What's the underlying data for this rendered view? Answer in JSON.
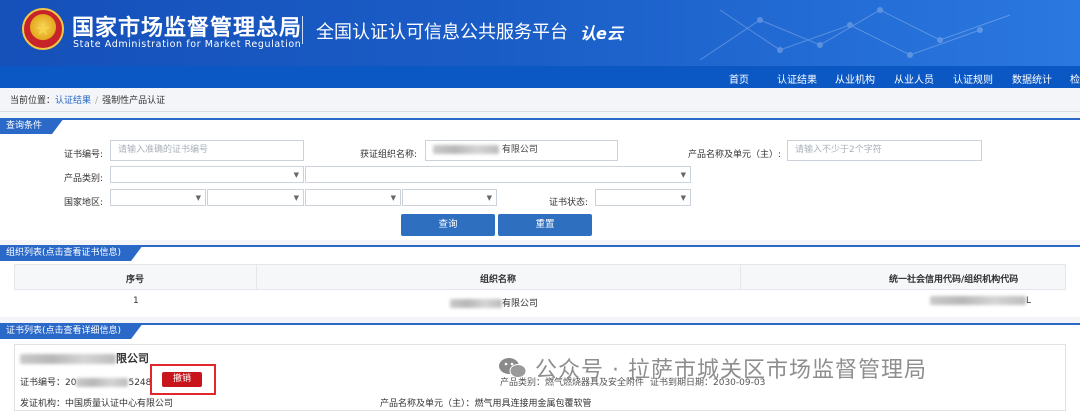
{
  "header": {
    "title_cn": "国家市场监督管理总局",
    "title_en": "State Administration  for  Market Regulation",
    "platform": "全国认证认可信息公共服务平台",
    "logo_text": "认e云"
  },
  "nav": {
    "items": [
      "首页",
      "认证结果",
      "从业机构",
      "从业人员",
      "认证规则",
      "数据统计",
      "检"
    ]
  },
  "breadcrumb": {
    "prefix": "当前位置：",
    "level1": "认证结果",
    "level2": "强制性产品认证"
  },
  "query": {
    "section_title": "查询条件",
    "cert_no_label": "证书编号:",
    "cert_no_placeholder": "请输入准确的证书编号",
    "org_label": "获证组织名称:",
    "org_value_suffix": "有限公司",
    "product_label": "产品名称及单元（主）:",
    "product_placeholder": "请输入不少于2个字符",
    "category_label": "产品类别:",
    "region_label": "国家地区:",
    "status_label": "证书状态:",
    "search_button": "查询",
    "reset_button": "重置"
  },
  "org_list": {
    "section_title": "组织列表(点击查看证书信息)",
    "columns": [
      "序号",
      "组织名称",
      "统一社会信用代码/组织机构代码"
    ],
    "rows": [
      {
        "index": "1",
        "name_suffix": "有限公司",
        "code_suffix": "L"
      }
    ]
  },
  "cert_list": {
    "section_title": "证书列表(点击查看详细信息)",
    "company_suffix": "限公司",
    "cert_no_label": "证书编号：",
    "cert_no_prefix": "20",
    "cert_no_suffix": "5248",
    "status_badge": "撤销",
    "category_text": "产品类别：燃气燃烧器具及安全附件",
    "expiry_text": "证书到期日期：2030-09-03",
    "issuer_label": "发证机构：",
    "issuer": "中国质量认证中心有限公司",
    "product_label": "产品名称及单元（主）：",
    "product": "燃气用具连接用金属包覆软管"
  },
  "watermark": {
    "text": "公众号 · 拉萨市城关区市场监督管理局"
  },
  "colors": {
    "brand_blue": "#1650b9",
    "nav_blue": "#0b58c4",
    "button_blue": "#2e6fbf",
    "revoked_red": "#c8151b"
  }
}
